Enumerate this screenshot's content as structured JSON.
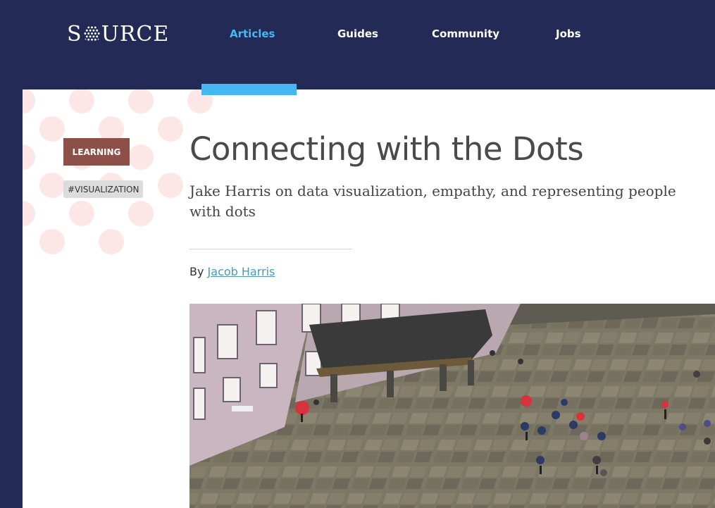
{
  "logo": {
    "text_before": "S",
    "text_after": "URCE",
    "dot_color": "#ffffff"
  },
  "nav": {
    "items": [
      {
        "label": "Articles",
        "active": true
      },
      {
        "label": "Guides",
        "active": false
      },
      {
        "label": "Community",
        "active": false
      },
      {
        "label": "Jobs",
        "active": false
      }
    ]
  },
  "article": {
    "category_tag": "LEARNING",
    "topic_tag": "#VISUALIZATION",
    "title": "Connecting with the Dots",
    "subtitle": "Jake Harris on data visualization, empathy, and representing people with dots",
    "byline_prefix": "By",
    "author": "Jacob Harris"
  },
  "colors": {
    "header_bg": "#232a56",
    "accent": "#45b8f2",
    "tag_bg": "#8c5048",
    "dot_pattern": "#fde7e6",
    "link": "#4a9ab8"
  }
}
